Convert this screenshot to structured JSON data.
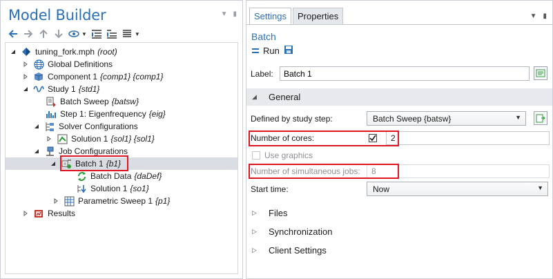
{
  "model_builder": {
    "title": "Model Builder",
    "tree": [
      {
        "name": "tuning_fork.mph",
        "tag": "(root)"
      },
      {
        "name": "Global Definitions",
        "tag": ""
      },
      {
        "name": "Component 1",
        "tag": "{comp1} {comp1}"
      },
      {
        "name": "Study 1",
        "tag": "{std1}"
      },
      {
        "name": "Batch Sweep",
        "tag": "{batsw}"
      },
      {
        "name": "Step 1: Eigenfrequency",
        "tag": "{eig}"
      },
      {
        "name": "Solver Configurations",
        "tag": ""
      },
      {
        "name": "Solution 1",
        "tag": "{sol1} {sol1}"
      },
      {
        "name": "Job Configurations",
        "tag": ""
      },
      {
        "name": "Batch 1",
        "tag": "{b1}"
      },
      {
        "name": "Batch Data",
        "tag": "{daDef}"
      },
      {
        "name": "Solution 1",
        "tag": "{so1}"
      },
      {
        "name": "Parametric Sweep 1",
        "tag": "{p1}"
      },
      {
        "name": "Results",
        "tag": ""
      }
    ]
  },
  "settings": {
    "tabs": [
      "Settings",
      "Properties"
    ],
    "node_title": "Batch",
    "run_label": "Run",
    "label_field": {
      "label": "Label:",
      "value": "Batch 1"
    },
    "general": {
      "header": "General",
      "defined_by_label": "Defined by study step:",
      "defined_by_value": "Batch Sweep {batsw}",
      "num_cores_label": "Number of cores:",
      "num_cores_checked": true,
      "num_cores_value": "2",
      "use_graphics_label": "Use graphics",
      "sim_jobs_label": "Number of simultaneous jobs:",
      "sim_jobs_value": "8",
      "start_time_label": "Start time:",
      "start_time_value": "Now"
    },
    "collapsed_sections": [
      "Files",
      "Synchronization",
      "Client Settings"
    ]
  },
  "colors": {
    "accent": "#2a6fb8",
    "highlight": "#e0141e",
    "selected_row": "#d9dde3"
  }
}
